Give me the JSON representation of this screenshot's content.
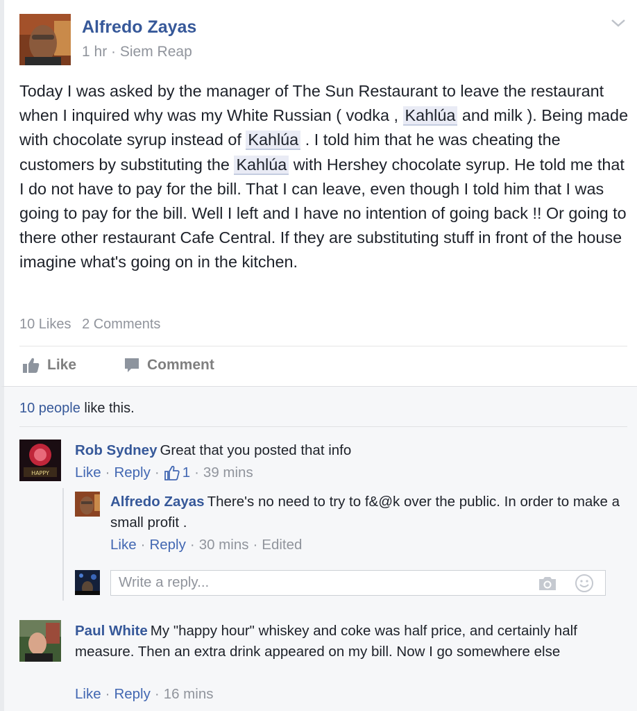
{
  "post": {
    "author": "Alfredo Zayas",
    "time": "1 hr",
    "separator": "·",
    "location": "Siem Reap",
    "body": [
      "Today I was asked by the manager of The Sun Restaurant to leave the restaurant when I inquired why was my White Russian ( vodka , ",
      "Kahlúa",
      " and milk ). Being made with chocolate syrup instead of ",
      "Kahlúa",
      " . I told him that he was cheating the customers by substituting the ",
      "Kahlúa",
      " with Hershey chocolate syrup. He told me that I do not have to pay for the bill. That I can leave, even though I told him that I was going to pay for the bill. Well I left and I have no intention of going back !! Or going to there other restaurant Cafe Central. If they are substituting stuff in front of the house imagine what's going on in the kitchen."
    ],
    "likes_count": "10 Likes",
    "comments_count": "2 Comments"
  },
  "actions": {
    "like": "Like",
    "comment": "Comment"
  },
  "summary": {
    "people_link": "10 people",
    "rest": " like this."
  },
  "comments": [
    {
      "name": "Rob Sydney",
      "text": "Great that you posted that info",
      "like": "Like",
      "reply": "Reply",
      "reactions": "1",
      "time": "39 mins",
      "replies": [
        {
          "name": "Alfredo Zayas",
          "text": "There's no need to try to f&@k over the public. In order to make a small profit .",
          "like": "Like",
          "reply": "Reply",
          "time": "30 mins",
          "edited": "Edited"
        }
      ]
    },
    {
      "name": "Paul White",
      "text": "My \"happy hour\" whiskey and coke was half price, and certainly half measure. Then an extra drink appeared on my bill. Now I go somewhere else",
      "like": "Like",
      "reply": "Reply",
      "time": "16 mins"
    }
  ],
  "reply_input": {
    "placeholder": "Write a reply..."
  },
  "colors": {
    "link": "#365899",
    "meta": "#90949c",
    "text": "#1d2129",
    "tag_bg": "#e9ebf5"
  },
  "icons": [
    "chevron-down-icon",
    "thumbs-up-icon",
    "comment-bubble-icon",
    "like-reaction-icon",
    "camera-icon",
    "smiley-icon"
  ]
}
